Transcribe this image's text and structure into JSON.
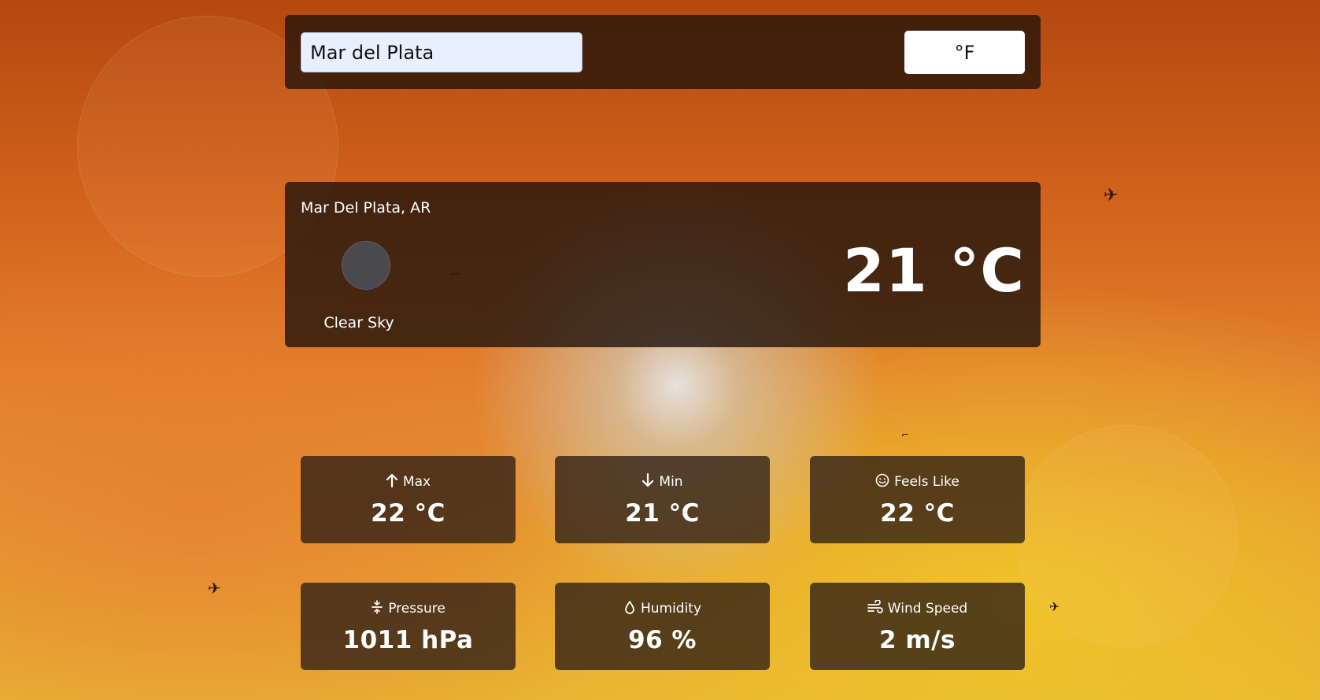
{
  "search": {
    "value": "Mar del Plata"
  },
  "unit_toggle": {
    "label": "°F"
  },
  "current": {
    "location": "Mar Del Plata, AR",
    "condition": "Clear Sky",
    "temperature": "21 °C"
  },
  "stats": [
    {
      "label": "Max",
      "value": "22 °C",
      "icon": "arrow-up-icon"
    },
    {
      "label": "Min",
      "value": "21 °C",
      "icon": "arrow-down-icon"
    },
    {
      "label": "Feels Like",
      "value": "22 °C",
      "icon": "smiley-icon"
    },
    {
      "label": "Pressure",
      "value": "1011 hPa",
      "icon": "pressure-icon"
    },
    {
      "label": "Humidity",
      "value": "96 %",
      "icon": "droplet-icon"
    },
    {
      "label": "Wind Speed",
      "value": "2 m/s",
      "icon": "wind-icon"
    }
  ]
}
